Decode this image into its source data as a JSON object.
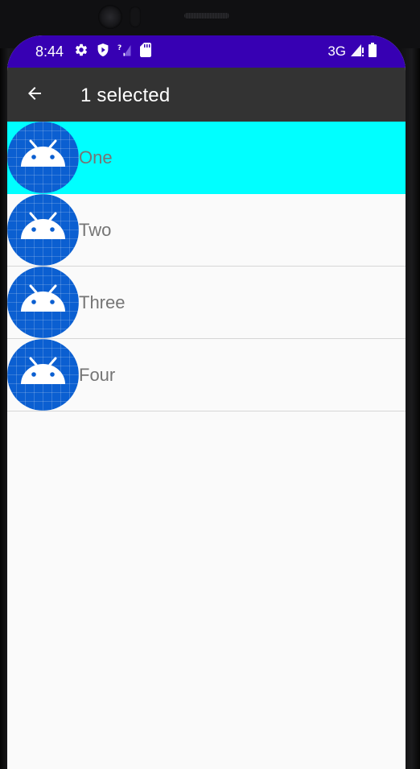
{
  "status_bar": {
    "time": "8:44",
    "network": "3G",
    "background_color": "#3700b3",
    "left_icons": [
      "settings-gear-icon",
      "shield-play-icon",
      "no-signal-icon",
      "sd-card-icon"
    ],
    "right_icons": [
      "cell-signal-icon",
      "battery-icon"
    ]
  },
  "app_bar": {
    "title": "1 selected",
    "back_icon": "arrow-left-icon",
    "background_color": "#333333"
  },
  "list": {
    "selected_color": "#00ffff",
    "avatar_color": "#0b5fd1",
    "avatar_icon": "android-robot-icon",
    "items": [
      {
        "label": "One",
        "selected": true
      },
      {
        "label": "Two",
        "selected": false
      },
      {
        "label": "Three",
        "selected": false
      },
      {
        "label": "Four",
        "selected": false
      }
    ]
  }
}
